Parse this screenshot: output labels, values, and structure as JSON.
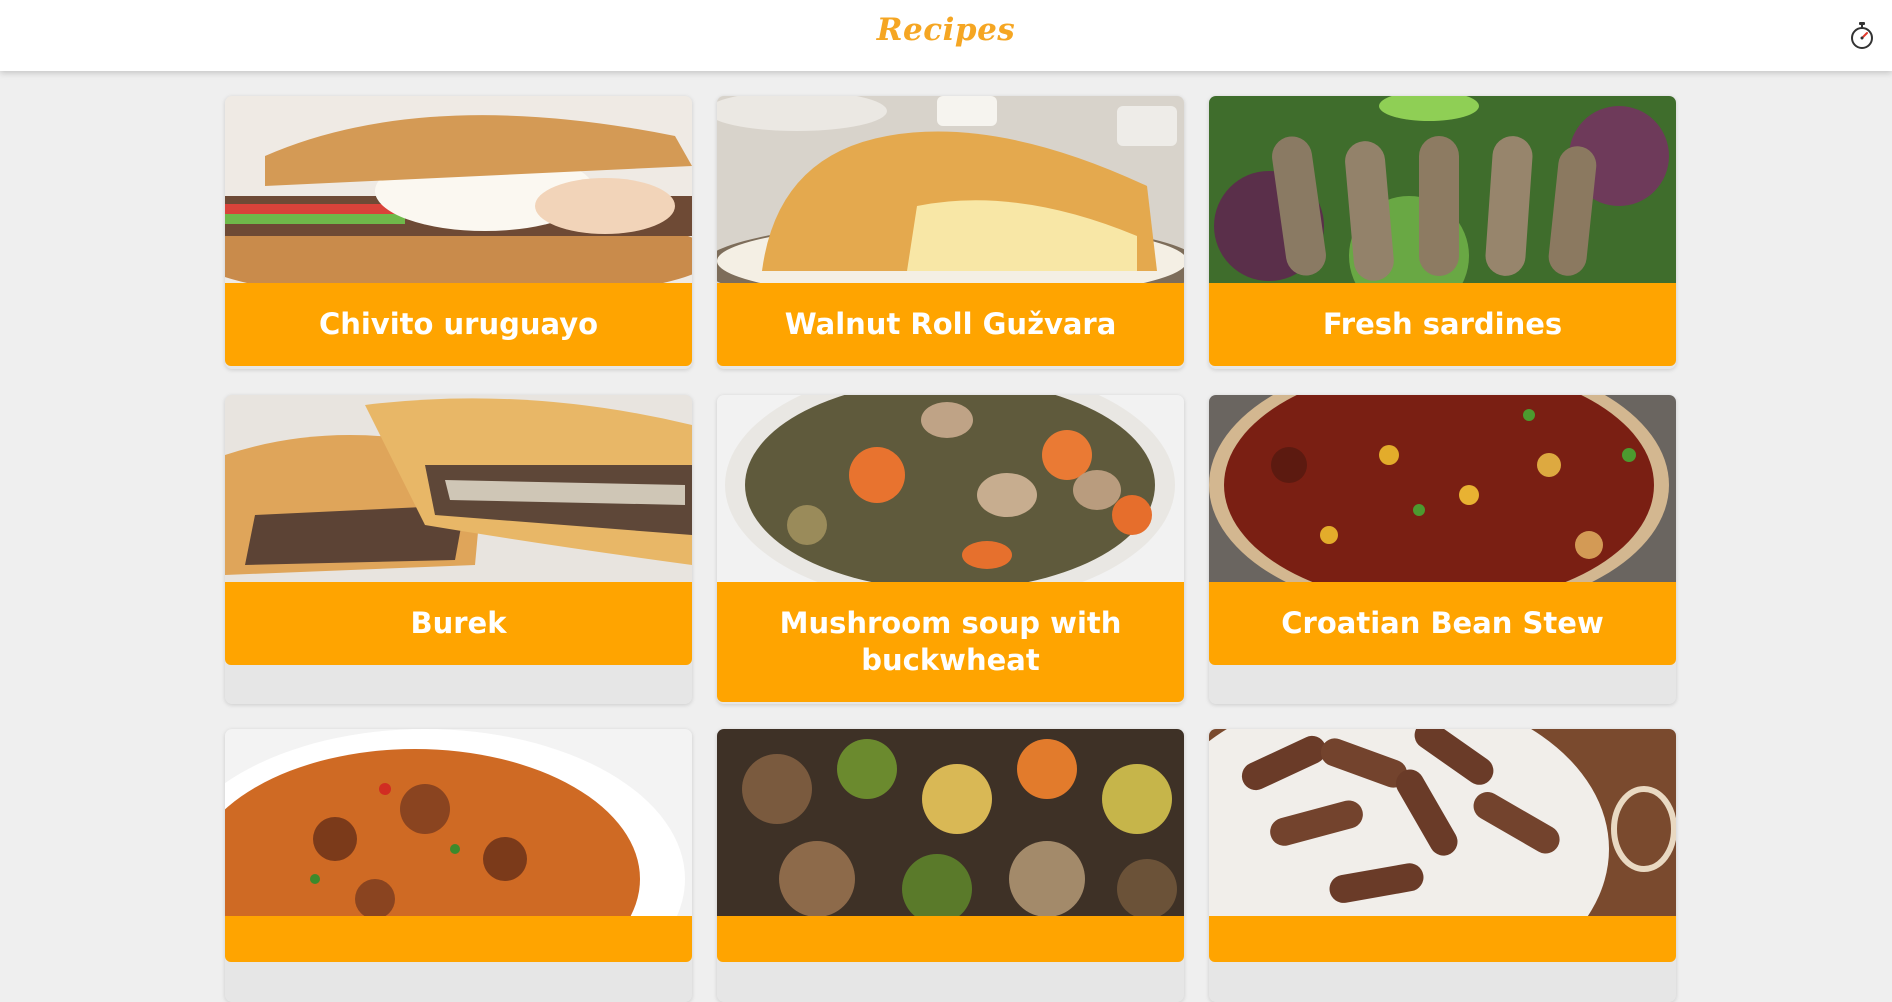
{
  "header": {
    "logo_text": "Recipes",
    "timer_icon": "stopwatch-icon"
  },
  "colors": {
    "accent": "#ffa400",
    "logo": "#f5a623",
    "background": "#efefef"
  },
  "recipes": [
    {
      "title": "Chivito uruguayo",
      "photo": "chivito-sandwich-photo"
    },
    {
      "title": "Walnut Roll Gužvara",
      "photo": "walnut-roll-photo"
    },
    {
      "title": "Fresh sardines",
      "photo": "sardines-photo"
    },
    {
      "title": "Burek",
      "photo": "burek-photo"
    },
    {
      "title": "Mushroom soup with buckwheat",
      "photo": "mushroom-soup-photo"
    },
    {
      "title": "Croatian Bean Stew",
      "photo": "bean-stew-photo"
    },
    {
      "title": "",
      "photo": "goulash-photo"
    },
    {
      "title": "",
      "photo": "roasted-meat-vegetables-photo"
    },
    {
      "title": "",
      "photo": "cevapi-photo"
    }
  ]
}
